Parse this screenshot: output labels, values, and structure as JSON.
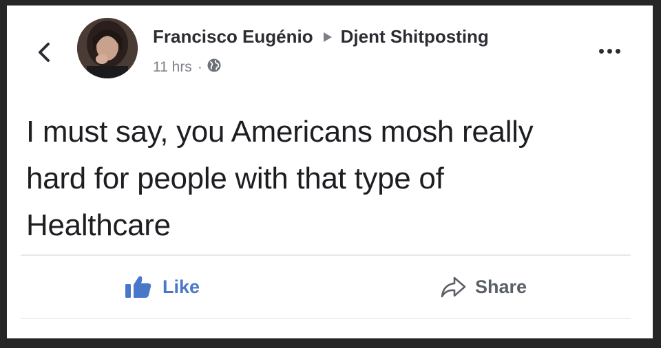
{
  "post": {
    "author": "Francisco Eugénio",
    "group": "Djent Shitposting",
    "time": "11 hrs",
    "separator": "·",
    "lines": [
      "I must say, you Americans mosh really",
      "hard for people with that type of",
      "Healthcare"
    ]
  },
  "actions": {
    "like_label": "Like",
    "share_label": "Share"
  },
  "icons": {
    "back": "chevron-left-icon",
    "arrow": "triangle-right-icon",
    "privacy": "globe-icon",
    "more": "more-horizontal-icon",
    "like": "thumbs-up-icon",
    "share": "share-arrow-icon"
  },
  "colors": {
    "like_blue": "#4a78c8",
    "text": "#1c1e21",
    "meta": "#7b7f87"
  }
}
